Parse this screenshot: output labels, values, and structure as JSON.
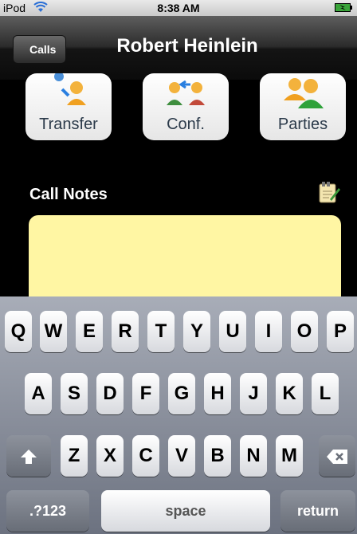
{
  "status_bar": {
    "carrier": "iPod",
    "time": "8:38 AM"
  },
  "nav": {
    "back_label": "Calls",
    "title": "Robert Heinlein"
  },
  "actions": [
    {
      "label": "Transfer",
      "icon": "transfer-icon"
    },
    {
      "label": "Conf.",
      "icon": "conference-icon"
    },
    {
      "label": "Parties",
      "icon": "parties-icon"
    }
  ],
  "notes": {
    "title": "Call Notes",
    "icon": "notes-edit-icon",
    "value": ""
  },
  "keyboard": {
    "row1": [
      "Q",
      "W",
      "E",
      "R",
      "T",
      "Y",
      "U",
      "I",
      "O",
      "P"
    ],
    "row2": [
      "A",
      "S",
      "D",
      "F",
      "G",
      "H",
      "J",
      "K",
      "L"
    ],
    "row3": [
      "Z",
      "X",
      "C",
      "V",
      "B",
      "N",
      "M"
    ],
    "numbers_label": ".?123",
    "space_label": "space",
    "return_label": "return"
  },
  "colors": {
    "notes_background": "#fff6a3",
    "nav_background": "#1a1a1a",
    "keyboard_background": "#8a8f99"
  }
}
